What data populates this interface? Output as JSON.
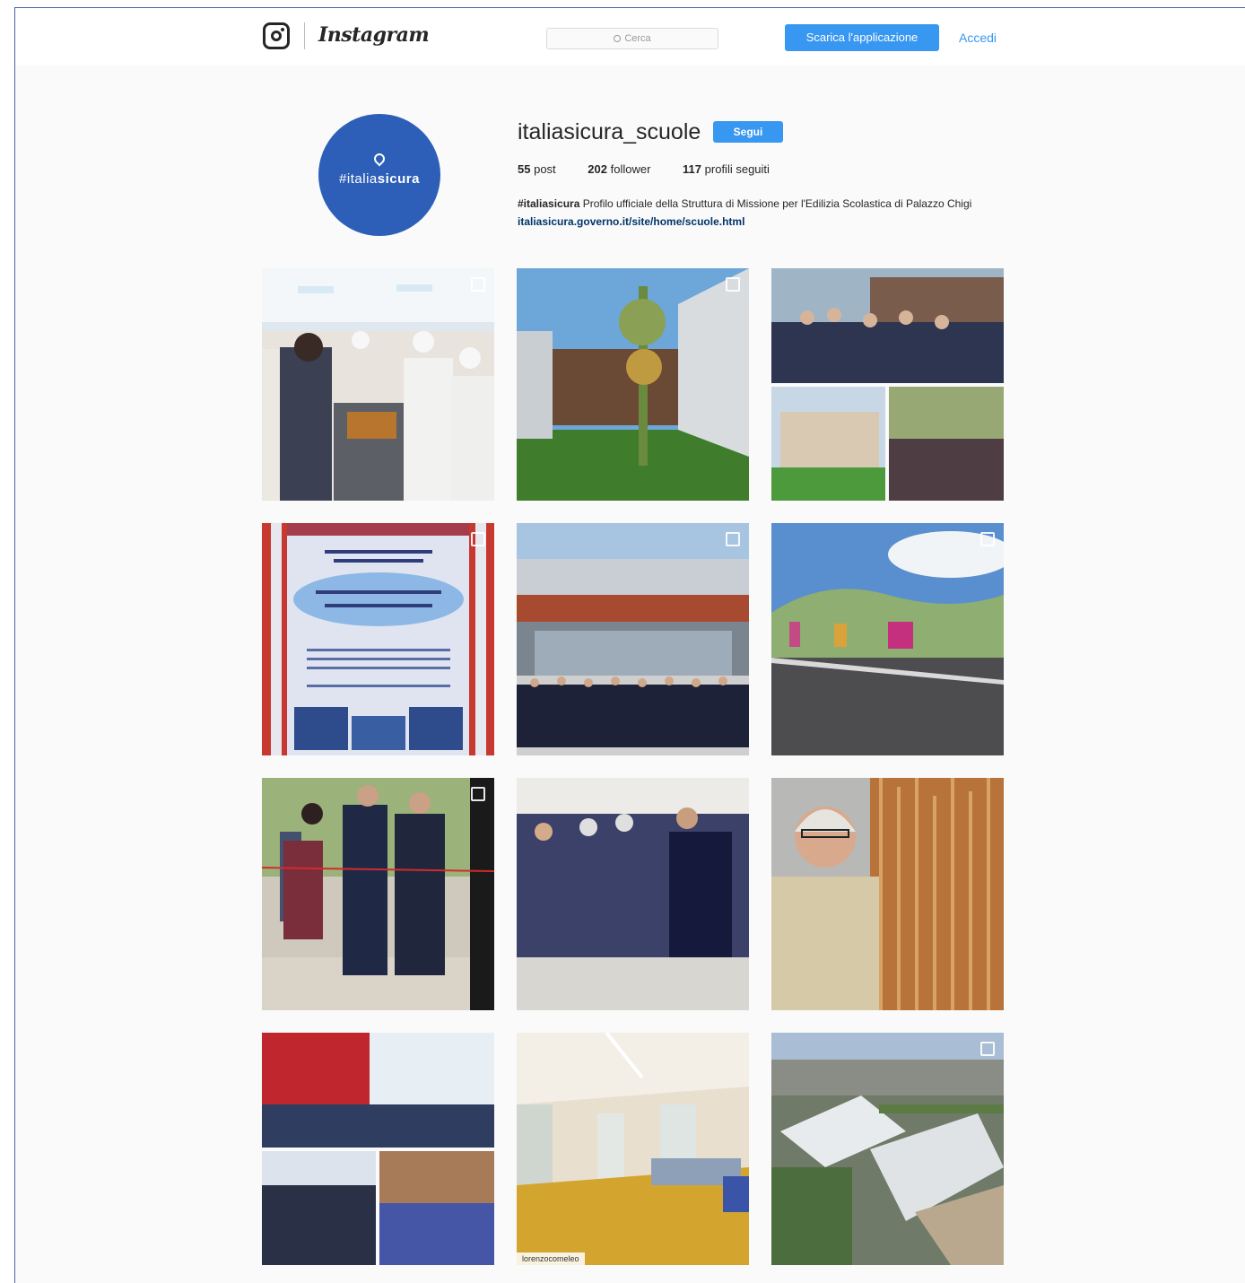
{
  "header": {
    "wordmark": "Instagram",
    "search_placeholder": "Cerca",
    "download_button": "Scarica l'applicazione",
    "login_link": "Accedi"
  },
  "profile": {
    "avatar_text_light": "#italia",
    "avatar_text_bold": "sicura",
    "username": "italiasicura_scuole",
    "follow_button": "Segui",
    "stats": {
      "posts_count": "55",
      "posts_label": "post",
      "followers_count": "202",
      "followers_label": "follower",
      "following_count": "117",
      "following_label": "profili seguiti"
    },
    "bio": {
      "hashtag": "#italiasicura",
      "text": " Profilo ufficiale della Struttura di Missione per l'Edilizia Scolastica di Palazzo Chigi ",
      "link": "italiasicura.governo.it/site/home/scuole.html"
    }
  },
  "posts": [
    {
      "subject": "school-kitchen-staff",
      "multi": true
    },
    {
      "subject": "school-courtyard",
      "multi": true
    },
    {
      "subject": "inauguration-collage",
      "multi": false
    },
    {
      "subject": "event-poster",
      "multi": true
    },
    {
      "subject": "school-building-crowd",
      "multi": true
    },
    {
      "subject": "green-school-building",
      "multi": true
    },
    {
      "subject": "ribbon-cutting",
      "multi": true
    },
    {
      "subject": "ceremony-crowd",
      "multi": false
    },
    {
      "subject": "architect-portrait",
      "multi": false
    },
    {
      "subject": "school-event-collage",
      "multi": false
    },
    {
      "subject": "school-hallway",
      "multi": false,
      "credit": "lorenzocomeleo"
    },
    {
      "subject": "aerial-campus",
      "multi": true
    }
  ],
  "colors": {
    "accent": "#3897f0",
    "avatar": "#2d5fb8",
    "link": "#003569"
  }
}
